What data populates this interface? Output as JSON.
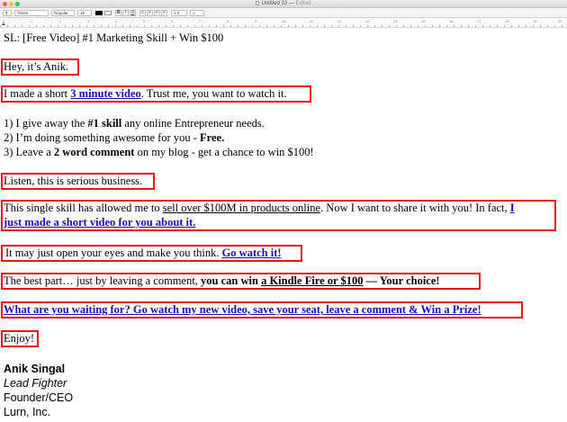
{
  "window": {
    "title": "Untitled 33",
    "status": "Edited"
  },
  "toolbar": {
    "style_menu": "¶",
    "font_family": "Times",
    "typeface": "Regular",
    "font_size": "18",
    "bold": "B",
    "italic": "I",
    "underline": "U",
    "spacing": "1.0",
    "list_style": "≡"
  },
  "ruler": {
    "marks": [
      "0",
      "1",
      "2",
      "3",
      "4",
      "5",
      "6",
      "7",
      "8",
      "9",
      "10",
      "11",
      "12",
      "13",
      "14",
      "15",
      "16",
      "17",
      "18",
      "19",
      "20"
    ]
  },
  "doc": {
    "subject": "SL: [Free Video] #1 Marketing Skill + Win $100",
    "greeting": "Hey, it’s Anik.",
    "p1": {
      "a": "I made a short ",
      "link": "3 minute video",
      "b": ". Trust me, you want to watch it."
    },
    "list": {
      "l1": {
        "a": "1) I give away the ",
        "bold": "#1 skill",
        "b": " any online Entrepreneur needs."
      },
      "l2": {
        "a": "2) I’m doing something awesome for you - ",
        "bold": "Free."
      },
      "l3": {
        "a": "3) Leave a ",
        "bold": "2 word comment",
        "b": " on my blog - get a chance to win $100!"
      }
    },
    "p2": "Listen, this is serious business.",
    "p3": {
      "a": "This single skill has allowed me to ",
      "u": "sell over $100M in products online",
      "b": ". Now I want to share it with you!  In fact, ",
      "link1": "I",
      "link2": "just made a short video for you about it."
    },
    "p4": {
      "a": "It may just open your eyes and make you think. ",
      "link": "Go watch it!"
    },
    "p5": {
      "a": "The best part… just by leaving a comment, ",
      "b1": "you can win ",
      "bu": "a Kindle Fire or $100",
      "b2": " — Your choice!"
    },
    "p6": "What are you waiting for? Go watch my new video, save your seat, leave a comment & Win a Prize!",
    "p7": "Enjoy!"
  },
  "signature": {
    "name": "Anik Singal",
    "role": "Lead Fighter",
    "title": "Founder/CEO",
    "company": "Lurn, Inc."
  },
  "colors": {
    "highlight_box": "#e8161c",
    "link": "#1a0dab"
  }
}
